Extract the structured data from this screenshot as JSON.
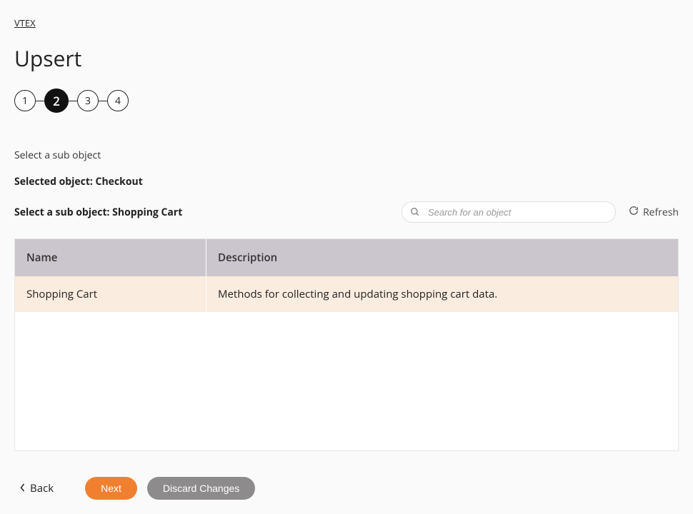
{
  "breadcrumb": {
    "label": "VTEX"
  },
  "page": {
    "title": "Upsert"
  },
  "wizard": {
    "steps": [
      "1",
      "2",
      "3",
      "4"
    ],
    "current": 2
  },
  "section": {
    "subhead": "Select a sub object",
    "selected_object_label": "Selected object: Checkout",
    "select_sub_label": "Select a sub object: Shopping Cart"
  },
  "search": {
    "placeholder": "Search for an object"
  },
  "refresh": {
    "label": "Refresh"
  },
  "table": {
    "columns": {
      "name": "Name",
      "description": "Description"
    },
    "rows": [
      {
        "name": "Shopping Cart",
        "description": "Methods for collecting and updating shopping cart data."
      }
    ]
  },
  "footer": {
    "back": "Back",
    "next": "Next",
    "discard": "Discard Changes"
  }
}
